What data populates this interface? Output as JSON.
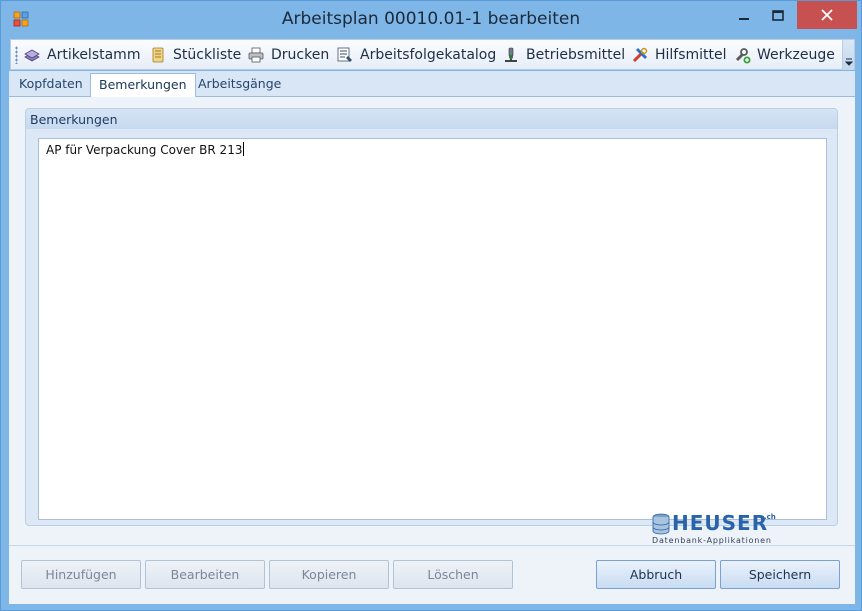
{
  "window": {
    "title": "Arbeitsplan 00010.01-1 bearbeiten"
  },
  "toolbar": {
    "items": [
      {
        "label": "Artikelstamm",
        "icon": "book-stack-icon"
      },
      {
        "label": "Stückliste",
        "icon": "list-scroll-icon"
      },
      {
        "label": "Drucken",
        "icon": "printer-icon"
      },
      {
        "label": "Arbeitsfolgekatalog",
        "icon": "catalog-list-icon"
      },
      {
        "label": "Betriebsmittel",
        "icon": "microscope-icon"
      },
      {
        "label": "Hilfsmittel",
        "icon": "tools-icon"
      },
      {
        "label": "Werkzeuge",
        "icon": "wrench-add-icon"
      }
    ]
  },
  "tabs": {
    "items": [
      {
        "label": "Kopfdaten",
        "active": false
      },
      {
        "label": "Bemerkungen",
        "active": true
      },
      {
        "label": "Arbeitsgänge",
        "active": false
      }
    ]
  },
  "remarks": {
    "group_title": "Bemerkungen",
    "text": "AP für Verpackung Cover BR 213"
  },
  "logo": {
    "name": "HEUSER",
    "suffix": ".ch",
    "tagline": "Datenbank-Applikationen"
  },
  "buttons": {
    "add": "Hinzufügen",
    "edit": "Bearbeiten",
    "copy": "Kopieren",
    "delete": "Löschen",
    "cancel": "Abbruch",
    "save": "Speichern"
  },
  "colors": {
    "titlebar": "#7fb6e8",
    "close_button": "#c75050",
    "accent": "#2a63a8"
  }
}
